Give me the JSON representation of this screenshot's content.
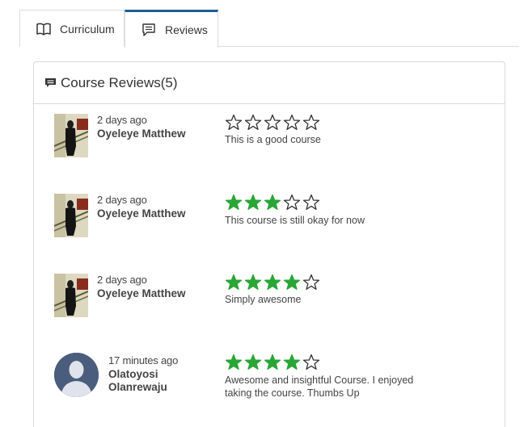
{
  "tabs": [
    {
      "label": "Curriculum",
      "icon": "book-icon",
      "active": false
    },
    {
      "label": "Reviews",
      "icon": "comment-icon",
      "active": true
    }
  ],
  "panel": {
    "title": "Course Reviews(5)",
    "icon": "comment-icon"
  },
  "colors": {
    "accent": "#1f5d8f",
    "star_filled": "#2aa636",
    "star_empty": "#333333"
  },
  "reviews": [
    {
      "time": "2 days ago",
      "name": "Oyeleye Matthew",
      "rating": 0,
      "max_rating": 5,
      "comment": "This is a good course",
      "avatar": "user-photo"
    },
    {
      "time": "2 days ago",
      "name": "Oyeleye Matthew",
      "rating": 3,
      "max_rating": 5,
      "comment": "This course is still okay for now",
      "avatar": "user-photo"
    },
    {
      "time": "2 days ago",
      "name": "Oyeleye Matthew",
      "rating": 4,
      "max_rating": 5,
      "comment": "Simply awesome",
      "avatar": "user-photo"
    },
    {
      "time": "17 minutes ago",
      "name": "Olatoyosi Olanrewaju",
      "rating": 4,
      "max_rating": 5,
      "comment": "Awesome and insightful Course. I enjoyed taking the course. Thumbs Up",
      "avatar": "default-avatar"
    }
  ]
}
